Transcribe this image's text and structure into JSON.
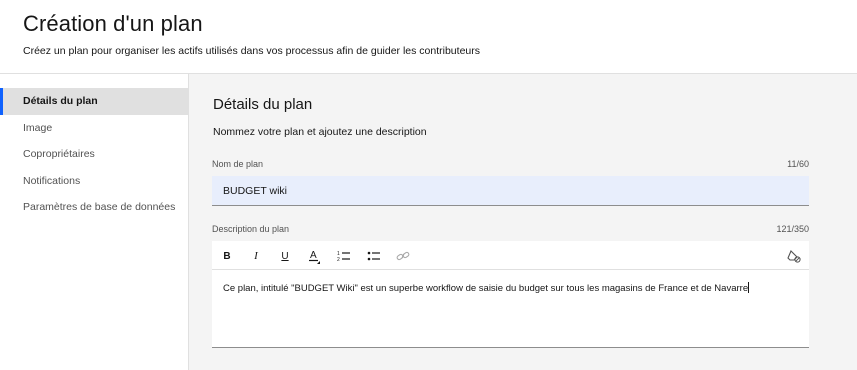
{
  "header": {
    "title": "Création d'un plan",
    "subtitle": "Créez un plan pour organiser les actifs utilisés dans vos processus afin de guider les contributeurs"
  },
  "sidebar": {
    "items": [
      {
        "label": "Détails du plan",
        "active": true
      },
      {
        "label": "Image",
        "active": false
      },
      {
        "label": "Copropriétaires",
        "active": false
      },
      {
        "label": "Notifications",
        "active": false
      },
      {
        "label": "Paramètres de base de données",
        "active": false
      }
    ]
  },
  "main": {
    "section_title": "Détails du plan",
    "section_desc": "Nommez votre plan et ajoutez une description",
    "name_field": {
      "label": "Nom de plan",
      "value": "BUDGET wiki",
      "counter": "11/60"
    },
    "description_field": {
      "label": "Description du plan",
      "counter": "121/350",
      "value": "Ce plan, intitulé \"BUDGET Wiki\" est un superbe workflow de saisie du budget sur tous les magasins de France et de Navarre"
    },
    "toolbar": {
      "bold": "B",
      "italic": "I",
      "underline": "U",
      "text_color": "A",
      "icons": [
        "bold-icon",
        "italic-icon",
        "underline-icon",
        "text-color-icon",
        "numbered-list-icon",
        "bulleted-list-icon",
        "link-icon",
        "clear-formatting-icon"
      ]
    }
  },
  "colors": {
    "accent": "#0f62fe",
    "input_fill": "#e8eefc",
    "panel_bg": "#f4f4f4",
    "active_item_bg": "#e0e0e0"
  }
}
